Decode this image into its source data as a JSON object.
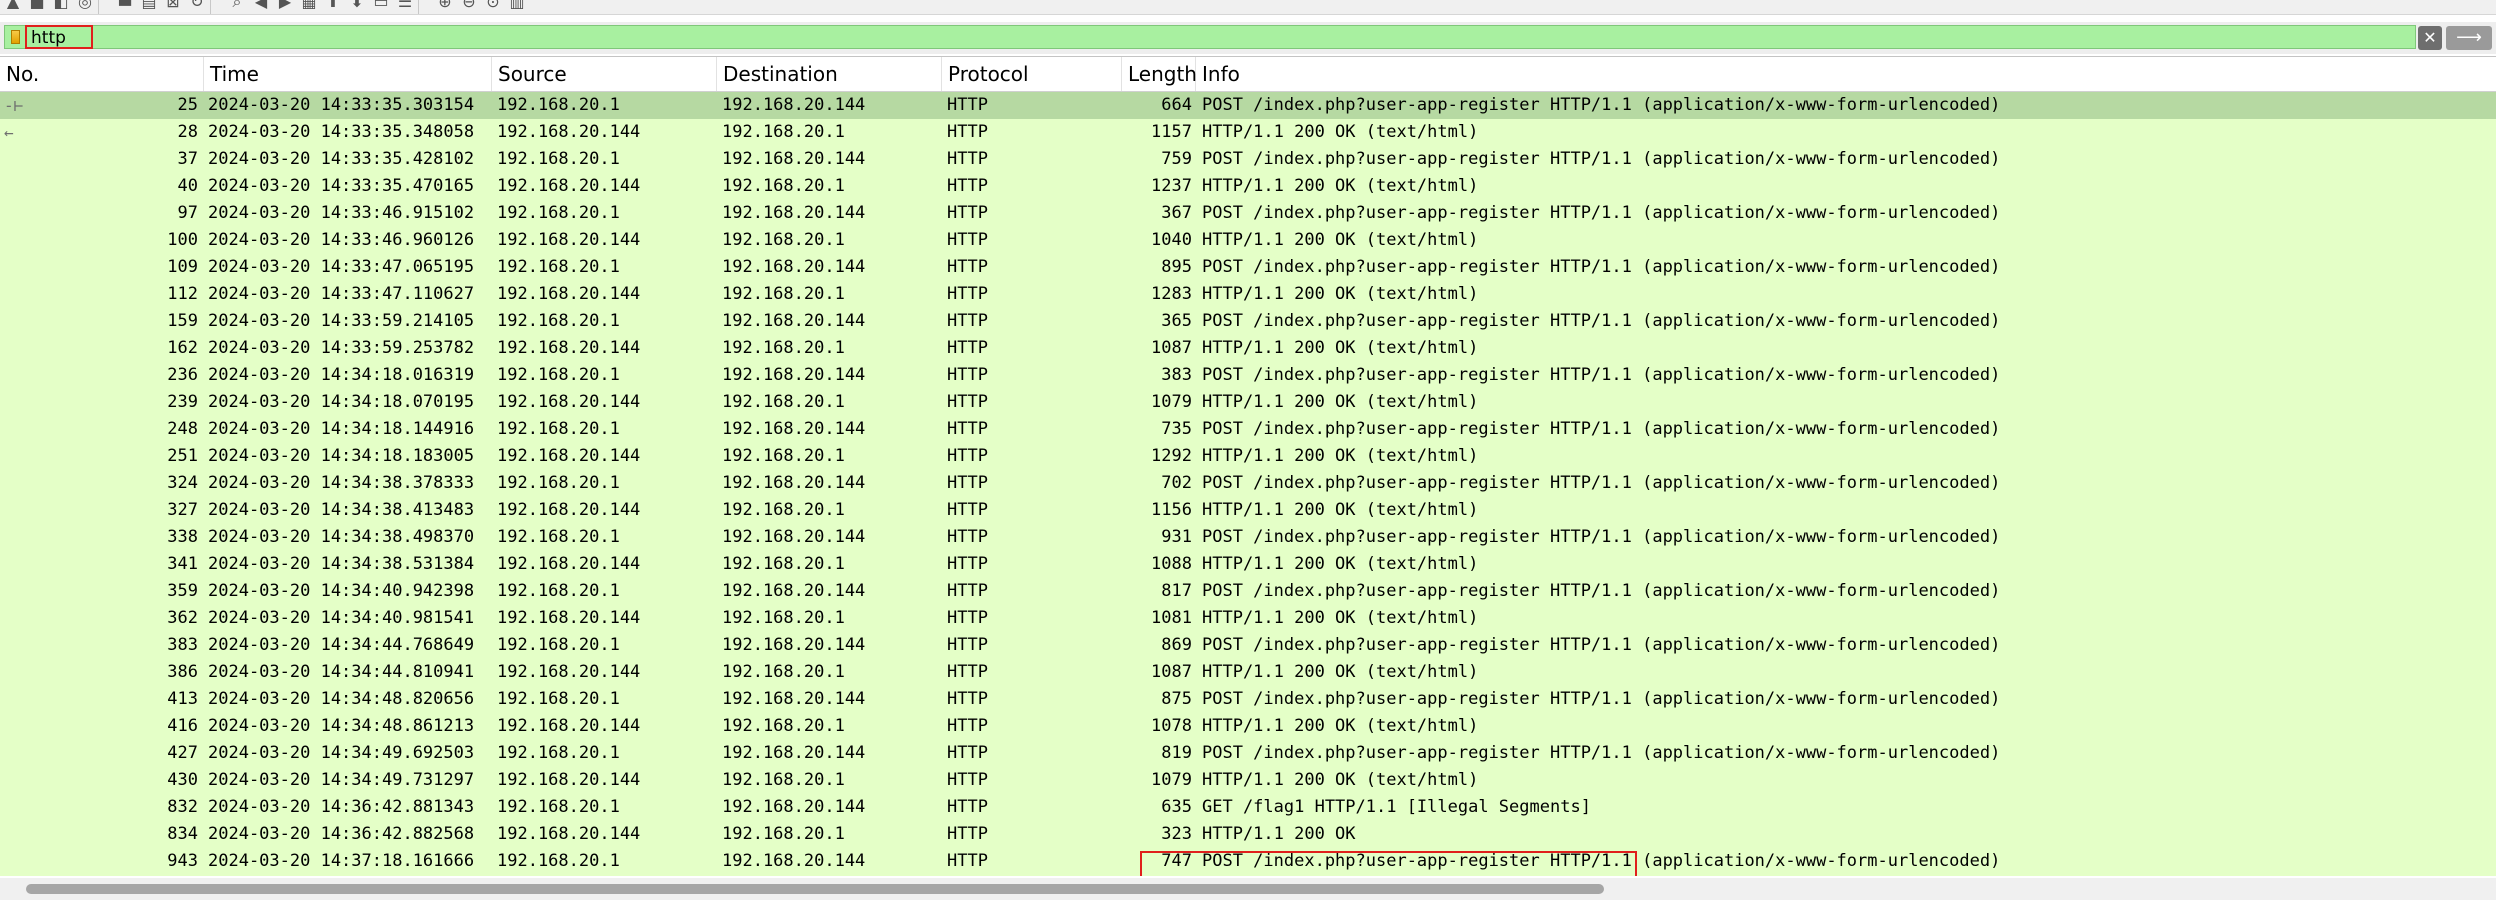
{
  "toolbar": {
    "icons": [
      "shark-fin-icon",
      "stop-icon",
      "restart-icon",
      "options-icon",
      "open-folder-icon",
      "save-icon",
      "close-file-icon",
      "reload-icon",
      "find-icon",
      "go-back-icon",
      "go-forward-icon",
      "go-to-packet-icon",
      "first-packet-icon",
      "last-packet-icon",
      "autoscroll-icon",
      "colorize-icon",
      "zoom-in-icon",
      "zoom-out-icon",
      "normal-size-icon",
      "resize-columns-icon"
    ]
  },
  "filter": {
    "value": "http",
    "clear_label": "✕",
    "apply_label": "⟶"
  },
  "columns": [
    "No.",
    "Time",
    "Source",
    "Destination",
    "Protocol",
    "Length",
    "Info"
  ],
  "packets": [
    {
      "no": "25",
      "time": "2024-03-20 14:33:35.303154",
      "src": "192.168.20.1",
      "dst": "192.168.20.144",
      "proto": "HTTP",
      "len": "664",
      "info": "POST /index.php?user-app-register HTTP/1.1  (application/x-www-form-urlencoded)",
      "selected": true,
      "mark": "-⊢"
    },
    {
      "no": "28",
      "time": "2024-03-20 14:33:35.348058",
      "src": "192.168.20.144",
      "dst": "192.168.20.1",
      "proto": "HTTP",
      "len": "1157",
      "info": "HTTP/1.1 200 OK  (text/html)",
      "mark": "←"
    },
    {
      "no": "37",
      "time": "2024-03-20 14:33:35.428102",
      "src": "192.168.20.1",
      "dst": "192.168.20.144",
      "proto": "HTTP",
      "len": "759",
      "info": "POST /index.php?user-app-register HTTP/1.1  (application/x-www-form-urlencoded)"
    },
    {
      "no": "40",
      "time": "2024-03-20 14:33:35.470165",
      "src": "192.168.20.144",
      "dst": "192.168.20.1",
      "proto": "HTTP",
      "len": "1237",
      "info": "HTTP/1.1 200 OK  (text/html)"
    },
    {
      "no": "97",
      "time": "2024-03-20 14:33:46.915102",
      "src": "192.168.20.1",
      "dst": "192.168.20.144",
      "proto": "HTTP",
      "len": "367",
      "info": "POST /index.php?user-app-register HTTP/1.1  (application/x-www-form-urlencoded)"
    },
    {
      "no": "100",
      "time": "2024-03-20 14:33:46.960126",
      "src": "192.168.20.144",
      "dst": "192.168.20.1",
      "proto": "HTTP",
      "len": "1040",
      "info": "HTTP/1.1 200 OK  (text/html)"
    },
    {
      "no": "109",
      "time": "2024-03-20 14:33:47.065195",
      "src": "192.168.20.1",
      "dst": "192.168.20.144",
      "proto": "HTTP",
      "len": "895",
      "info": "POST /index.php?user-app-register HTTP/1.1  (application/x-www-form-urlencoded)"
    },
    {
      "no": "112",
      "time": "2024-03-20 14:33:47.110627",
      "src": "192.168.20.144",
      "dst": "192.168.20.1",
      "proto": "HTTP",
      "len": "1283",
      "info": "HTTP/1.1 200 OK  (text/html)"
    },
    {
      "no": "159",
      "time": "2024-03-20 14:33:59.214105",
      "src": "192.168.20.1",
      "dst": "192.168.20.144",
      "proto": "HTTP",
      "len": "365",
      "info": "POST /index.php?user-app-register HTTP/1.1  (application/x-www-form-urlencoded)"
    },
    {
      "no": "162",
      "time": "2024-03-20 14:33:59.253782",
      "src": "192.168.20.144",
      "dst": "192.168.20.1",
      "proto": "HTTP",
      "len": "1087",
      "info": "HTTP/1.1 200 OK  (text/html)"
    },
    {
      "no": "236",
      "time": "2024-03-20 14:34:18.016319",
      "src": "192.168.20.1",
      "dst": "192.168.20.144",
      "proto": "HTTP",
      "len": "383",
      "info": "POST /index.php?user-app-register HTTP/1.1  (application/x-www-form-urlencoded)"
    },
    {
      "no": "239",
      "time": "2024-03-20 14:34:18.070195",
      "src": "192.168.20.144",
      "dst": "192.168.20.1",
      "proto": "HTTP",
      "len": "1079",
      "info": "HTTP/1.1 200 OK  (text/html)"
    },
    {
      "no": "248",
      "time": "2024-03-20 14:34:18.144916",
      "src": "192.168.20.1",
      "dst": "192.168.20.144",
      "proto": "HTTP",
      "len": "735",
      "info": "POST /index.php?user-app-register HTTP/1.1  (application/x-www-form-urlencoded)"
    },
    {
      "no": "251",
      "time": "2024-03-20 14:34:18.183005",
      "src": "192.168.20.144",
      "dst": "192.168.20.1",
      "proto": "HTTP",
      "len": "1292",
      "info": "HTTP/1.1 200 OK  (text/html)"
    },
    {
      "no": "324",
      "time": "2024-03-20 14:34:38.378333",
      "src": "192.168.20.1",
      "dst": "192.168.20.144",
      "proto": "HTTP",
      "len": "702",
      "info": "POST /index.php?user-app-register HTTP/1.1  (application/x-www-form-urlencoded)"
    },
    {
      "no": "327",
      "time": "2024-03-20 14:34:38.413483",
      "src": "192.168.20.144",
      "dst": "192.168.20.1",
      "proto": "HTTP",
      "len": "1156",
      "info": "HTTP/1.1 200 OK  (text/html)"
    },
    {
      "no": "338",
      "time": "2024-03-20 14:34:38.498370",
      "src": "192.168.20.1",
      "dst": "192.168.20.144",
      "proto": "HTTP",
      "len": "931",
      "info": "POST /index.php?user-app-register HTTP/1.1  (application/x-www-form-urlencoded)"
    },
    {
      "no": "341",
      "time": "2024-03-20 14:34:38.531384",
      "src": "192.168.20.144",
      "dst": "192.168.20.1",
      "proto": "HTTP",
      "len": "1088",
      "info": "HTTP/1.1 200 OK  (text/html)"
    },
    {
      "no": "359",
      "time": "2024-03-20 14:34:40.942398",
      "src": "192.168.20.1",
      "dst": "192.168.20.144",
      "proto": "HTTP",
      "len": "817",
      "info": "POST /index.php?user-app-register HTTP/1.1  (application/x-www-form-urlencoded)"
    },
    {
      "no": "362",
      "time": "2024-03-20 14:34:40.981541",
      "src": "192.168.20.144",
      "dst": "192.168.20.1",
      "proto": "HTTP",
      "len": "1081",
      "info": "HTTP/1.1 200 OK  (text/html)"
    },
    {
      "no": "383",
      "time": "2024-03-20 14:34:44.768649",
      "src": "192.168.20.1",
      "dst": "192.168.20.144",
      "proto": "HTTP",
      "len": "869",
      "info": "POST /index.php?user-app-register HTTP/1.1  (application/x-www-form-urlencoded)"
    },
    {
      "no": "386",
      "time": "2024-03-20 14:34:44.810941",
      "src": "192.168.20.144",
      "dst": "192.168.20.1",
      "proto": "HTTP",
      "len": "1087",
      "info": "HTTP/1.1 200 OK  (text/html)"
    },
    {
      "no": "413",
      "time": "2024-03-20 14:34:48.820656",
      "src": "192.168.20.1",
      "dst": "192.168.20.144",
      "proto": "HTTP",
      "len": "875",
      "info": "POST /index.php?user-app-register HTTP/1.1  (application/x-www-form-urlencoded)"
    },
    {
      "no": "416",
      "time": "2024-03-20 14:34:48.861213",
      "src": "192.168.20.144",
      "dst": "192.168.20.1",
      "proto": "HTTP",
      "len": "1078",
      "info": "HTTP/1.1 200 OK  (text/html)"
    },
    {
      "no": "427",
      "time": "2024-03-20 14:34:49.692503",
      "src": "192.168.20.1",
      "dst": "192.168.20.144",
      "proto": "HTTP",
      "len": "819",
      "info": "POST /index.php?user-app-register HTTP/1.1  (application/x-www-form-urlencoded)"
    },
    {
      "no": "430",
      "time": "2024-03-20 14:34:49.731297",
      "src": "192.168.20.144",
      "dst": "192.168.20.1",
      "proto": "HTTP",
      "len": "1079",
      "info": "HTTP/1.1 200 OK  (text/html)"
    },
    {
      "no": "832",
      "time": "2024-03-20 14:36:42.881343",
      "src": "192.168.20.1",
      "dst": "192.168.20.144",
      "proto": "HTTP",
      "len": "635",
      "info": "GET /flag1 HTTP/1.1 [Illegal Segments]",
      "highlighted": true
    },
    {
      "no": "834",
      "time": "2024-03-20 14:36:42.882568",
      "src": "192.168.20.144",
      "dst": "192.168.20.1",
      "proto": "HTTP",
      "len": "323",
      "info": "HTTP/1.1 200 OK"
    },
    {
      "no": "943",
      "time": "2024-03-20 14:37:18.161666",
      "src": "192.168.20.1",
      "dst": "192.168.20.144",
      "proto": "HTTP",
      "len": "747",
      "info": "POST /index.php?user-app-register HTTP/1.1  (application/x-www-form-urlencoded)"
    }
  ],
  "colors": {
    "row_background": "#e4ffc7",
    "selected_row": "#b6d9a2",
    "filter_valid": "#a8f0a0",
    "annotation_red": "#e0201c"
  }
}
